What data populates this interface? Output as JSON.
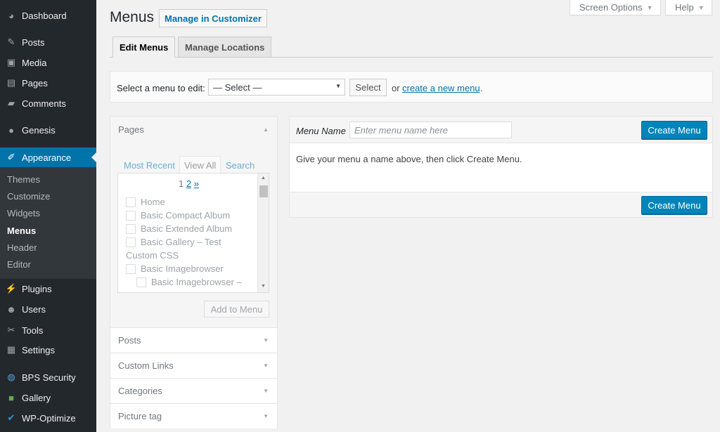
{
  "sidebar": {
    "items": [
      {
        "label": "Dashboard",
        "icon": "dashboard-icon"
      },
      {
        "label": "Posts",
        "icon": "pin-icon"
      },
      {
        "label": "Media",
        "icon": "media-icon"
      },
      {
        "label": "Pages",
        "icon": "pages-icon"
      },
      {
        "label": "Comments",
        "icon": "comment-icon"
      },
      {
        "label": "Genesis",
        "icon": "genesis-icon"
      },
      {
        "label": "Appearance",
        "icon": "brush-icon"
      },
      {
        "label": "Plugins",
        "icon": "plug-icon"
      },
      {
        "label": "Users",
        "icon": "user-icon"
      },
      {
        "label": "Tools",
        "icon": "wrench-icon"
      },
      {
        "label": "Settings",
        "icon": "settings-icon"
      },
      {
        "label": "BPS Security",
        "icon": "globe-icon"
      },
      {
        "label": "Gallery",
        "icon": "gallery-icon"
      },
      {
        "label": "WP-Optimize",
        "icon": "check-circle-icon"
      }
    ],
    "submenu": [
      "Themes",
      "Customize",
      "Widgets",
      "Menus",
      "Header",
      "Editor"
    ],
    "active_item": "Appearance",
    "current_submenu": "Menus"
  },
  "top_buttons": {
    "screen_options": "Screen Options",
    "help": "Help"
  },
  "header": {
    "title": "Menus",
    "customizer_button": "Manage in Customizer"
  },
  "tabs": {
    "edit": "Edit Menus",
    "locations": "Manage Locations"
  },
  "select_bar": {
    "label": "Select a menu to edit:",
    "selected": "— Select —",
    "button": "Select",
    "or": "or",
    "link": "create a new menu",
    "period": "."
  },
  "left": {
    "pages_title": "Pages",
    "page_tabs": [
      "Most Recent",
      "View All",
      "Search"
    ],
    "pager_current": "1",
    "pager_links": [
      "2",
      "»"
    ],
    "page_items": [
      {
        "label": "Home",
        "checkbox": true
      },
      {
        "label": "Basic Compact Album",
        "checkbox": true
      },
      {
        "label": "Basic Extended Album",
        "checkbox": true
      },
      {
        "label": "Basic Gallery – Test",
        "checkbox": true
      },
      {
        "label": "Custom CSS",
        "checkbox": false
      },
      {
        "label": "Basic Imagebrowser",
        "checkbox": true
      },
      {
        "label": "Basic Imagebrowser –",
        "checkbox": true
      }
    ],
    "add_button": "Add to Menu",
    "sections": [
      "Posts",
      "Custom Links",
      "Categories",
      "Picture tag"
    ]
  },
  "right": {
    "name_label": "Menu Name",
    "name_placeholder": "Enter menu name here",
    "create_button": "Create Menu",
    "instruction": "Give your menu a name above, then click Create Menu."
  },
  "colors": {
    "sidebar_bg": "#23282d",
    "submenu_bg": "#32373c",
    "accent": "#0073aa",
    "primary_button": "#0085ba"
  }
}
